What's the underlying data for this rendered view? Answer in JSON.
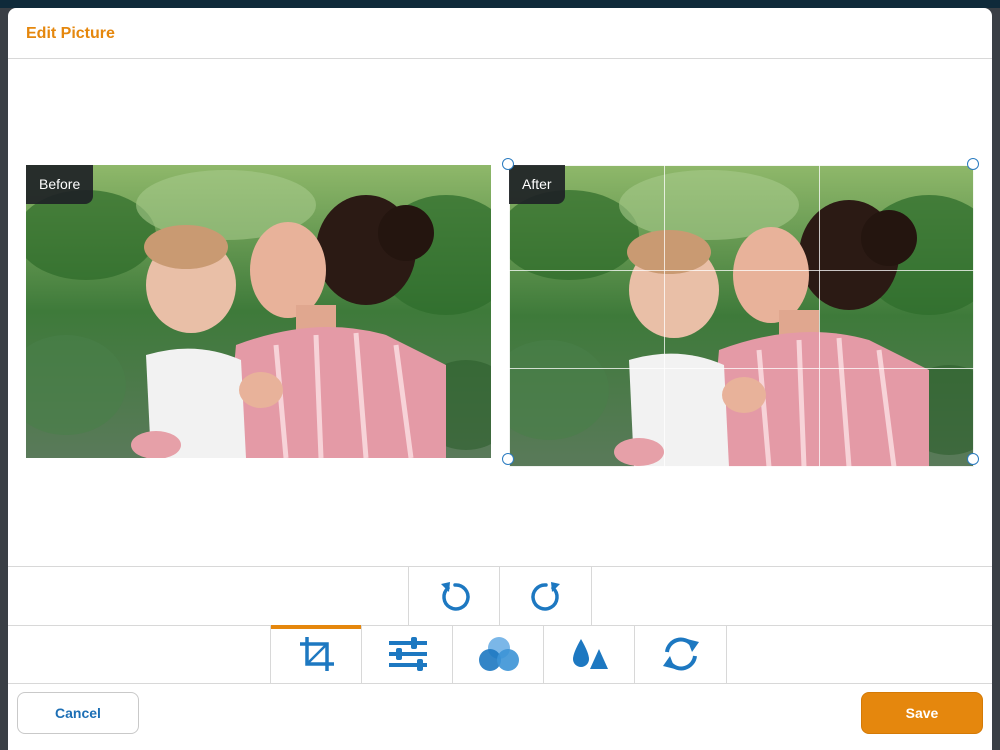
{
  "dialog": {
    "title": "Edit Picture"
  },
  "preview": {
    "before_label": "Before",
    "after_label": "After"
  },
  "rotate_tools": [
    {
      "name": "rotate-left-icon"
    },
    {
      "name": "rotate-right-icon"
    }
  ],
  "edit_tools": [
    {
      "name": "crop-icon",
      "active": true
    },
    {
      "name": "adjust-sliders-icon",
      "active": false
    },
    {
      "name": "color-circles-icon",
      "active": false
    },
    {
      "name": "drop-triangle-icon",
      "active": false
    },
    {
      "name": "refresh-icon",
      "active": false
    }
  ],
  "footer": {
    "cancel_label": "Cancel",
    "save_label": "Save"
  },
  "colors": {
    "accent": "#e5870d",
    "icon_blue": "#1d78c1",
    "cancel_text": "#1d6fb5"
  }
}
